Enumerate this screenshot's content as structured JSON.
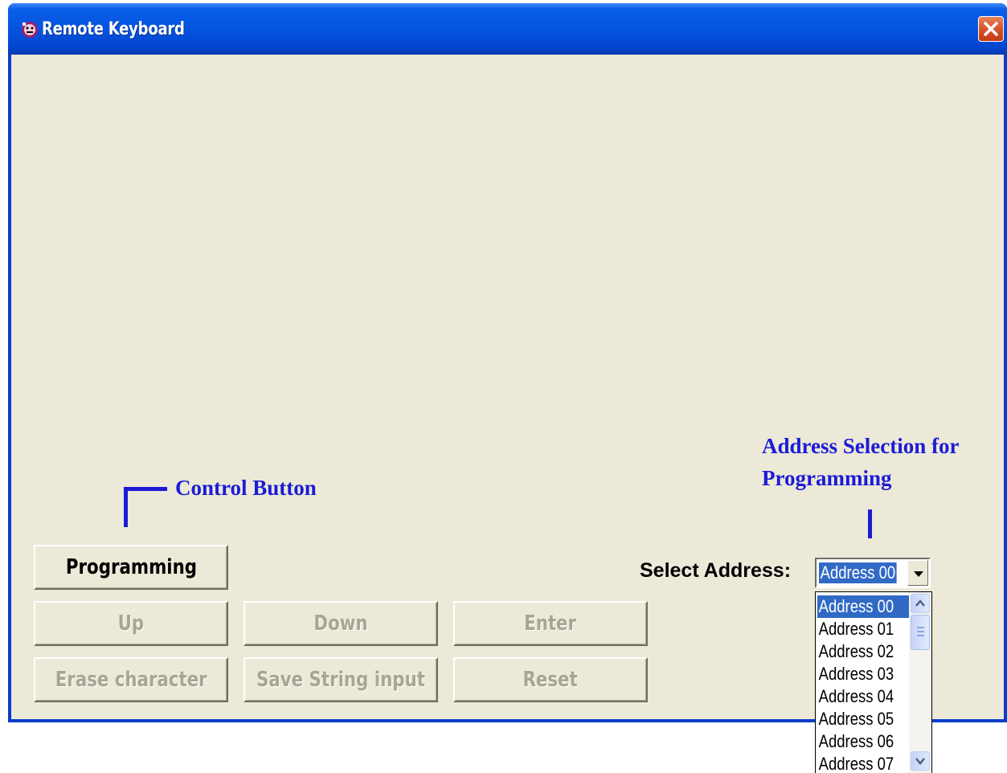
{
  "window": {
    "title": "Remote Keyboard",
    "app_icon": "gear-face-icon",
    "close_icon": "close-icon",
    "accent_color": "#0454e0",
    "close_color": "#d9542a"
  },
  "annotations": {
    "control_button": "Control Button",
    "address_selection_line1": "Address Selection for",
    "address_selection_line2": "Programming",
    "color": "#1b1bd6"
  },
  "buttons": {
    "programming": "Programming",
    "up": "Up",
    "down": "Down",
    "enter": "Enter",
    "erase_character": "Erase character",
    "save_string_input": "Save String input",
    "reset": "Reset"
  },
  "address": {
    "label": "Select Address:",
    "selected": "Address 00",
    "options": [
      "Address 00",
      "Address 01",
      "Address 02",
      "Address 03",
      "Address 04",
      "Address 05",
      "Address 06",
      "Address 07"
    ],
    "highlight_color": "#316ac5"
  }
}
